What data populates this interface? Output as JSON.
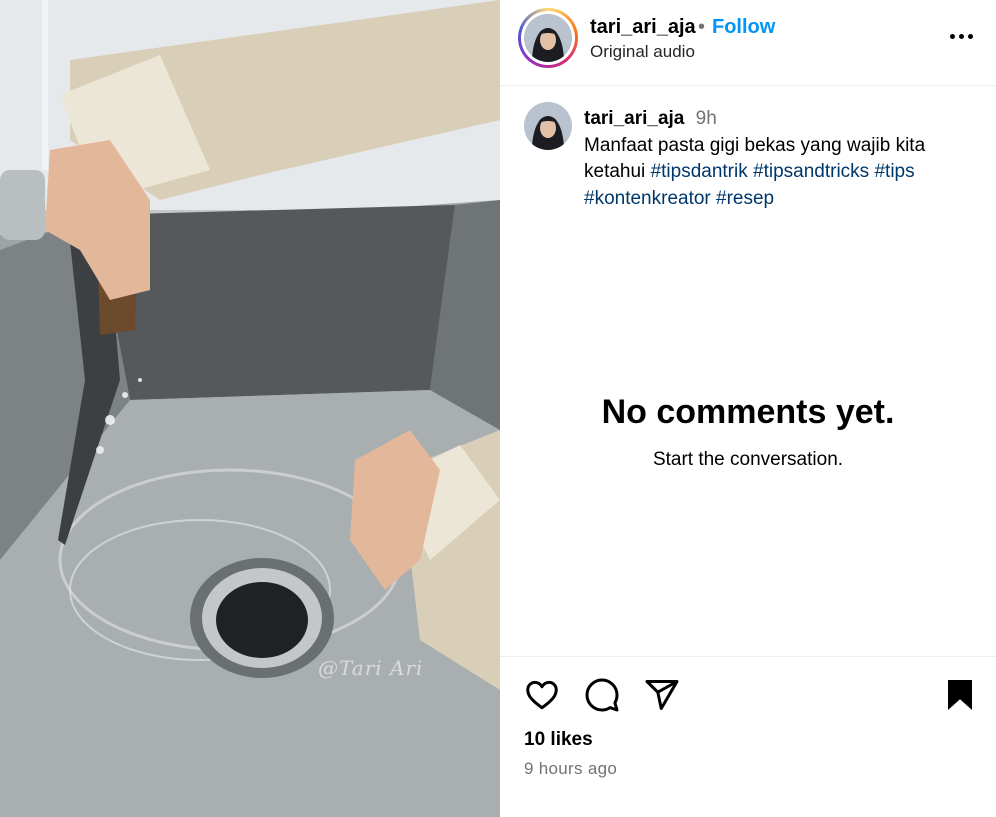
{
  "post": {
    "username": "tari_ari_aja",
    "separator": "•",
    "follow_label": "Follow",
    "audio_label": "Original audio",
    "watermark": "@Tari Ari"
  },
  "caption": {
    "username": "tari_ari_aja",
    "time": "9h",
    "text": "Manfaat pasta gigi bekas yang wajib kita ketahui",
    "hashtags": [
      "#tipsdantrik",
      "#tipsandtricks",
      "#tips",
      "#kontenkreator",
      "#resep"
    ]
  },
  "comments": {
    "empty_title": "No comments yet.",
    "empty_subtitle": "Start the conversation."
  },
  "footer": {
    "likes": "10 likes",
    "posted": "9 hours ago"
  },
  "icons": {
    "like": "heart-icon",
    "comment": "comment-icon",
    "share": "share-icon",
    "save": "bookmark-icon",
    "more": "more-icon"
  },
  "colors": {
    "follow": "#0095f6",
    "hashtag": "#00376b",
    "muted": "#737373"
  }
}
